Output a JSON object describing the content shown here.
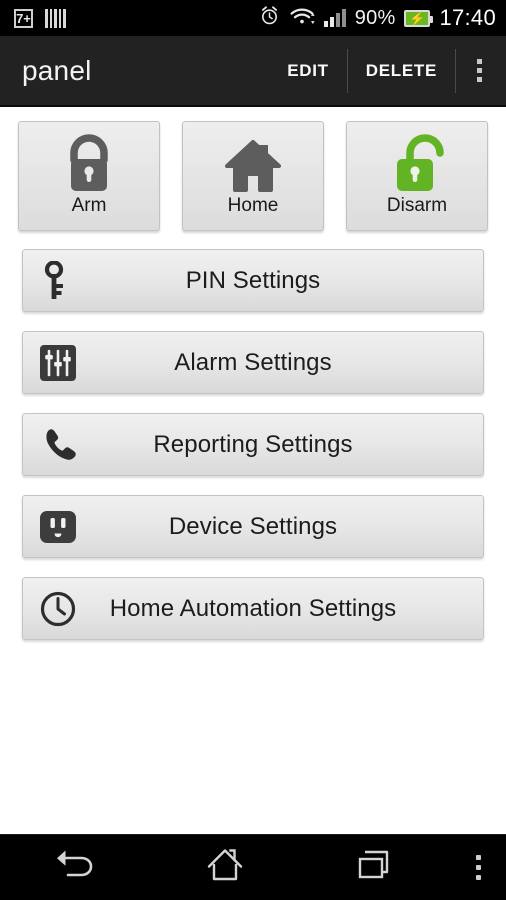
{
  "status_bar": {
    "left_icons": [
      {
        "name": "seven-plus-icon",
        "label": "7+"
      },
      {
        "name": "barcode-icon",
        "label": ""
      }
    ],
    "alarm_icon": "alarm-clock-icon",
    "wifi_icon": "wifi-icon",
    "signal_icon": "cellular-signal-icon",
    "battery_percent": "90%",
    "battery_icon": "battery-charging-icon",
    "time": "17:40"
  },
  "action_bar": {
    "title": "panel",
    "edit_label": "EDIT",
    "delete_label": "DELETE",
    "overflow_icon": "overflow-menu-icon"
  },
  "modes": [
    {
      "label": "Arm",
      "icon": "padlock-locked-icon",
      "color": "#5d5d5d"
    },
    {
      "label": "Home",
      "icon": "house-icon",
      "color": "#5d5d5d"
    },
    {
      "label": "Disarm",
      "icon": "padlock-unlocked-icon",
      "color": "#63b424"
    }
  ],
  "settings_rows": [
    {
      "label": "PIN Settings",
      "icon": "key-icon"
    },
    {
      "label": "Alarm Settings",
      "icon": "equalizer-sliders-icon"
    },
    {
      "label": "Reporting Settings",
      "icon": "phone-handset-icon"
    },
    {
      "label": "Device Settings",
      "icon": "power-outlet-icon"
    },
    {
      "label": "Home Automation Settings",
      "icon": "clock-icon"
    }
  ],
  "navigation_bar": [
    {
      "name": "back-button",
      "icon": "back-arrow-icon"
    },
    {
      "name": "home-button",
      "icon": "home-outline-icon"
    },
    {
      "name": "recents-button",
      "icon": "recent-apps-icon"
    },
    {
      "name": "menu-button",
      "icon": "overflow-menu-icon"
    }
  ],
  "colors": {
    "accent_green": "#63b424",
    "icon_gray": "#5d5d5d",
    "action_bar_bg": "#222222",
    "status_bar_bg": "#000000"
  }
}
